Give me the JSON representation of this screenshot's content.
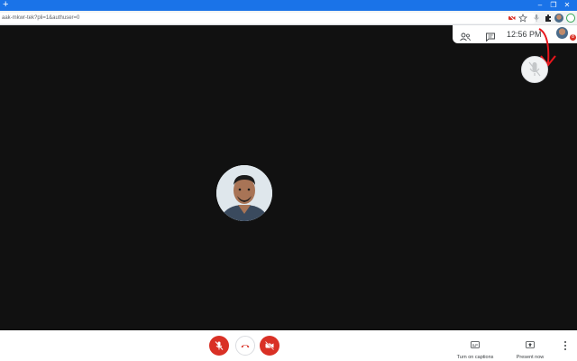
{
  "browser": {
    "new_tab_symbol": "+",
    "url": "aak-mkwr-tek?pli=1&authuser=0",
    "window_controls": [
      "–",
      "❐",
      "✕"
    ]
  },
  "meet": {
    "clock": "12:56 PM",
    "notification_count": "8",
    "bottom": {
      "captions_label": "Turn on captions",
      "present_label": "Present now"
    }
  },
  "colors": {
    "brand_blue": "#1a73e8",
    "meeting_background": "#111111",
    "danger_red": "#d93025",
    "annotation_arrow": "#e8161c"
  },
  "icons": [
    "new-tab-icon",
    "minimize-icon",
    "maximize-icon",
    "close-icon",
    "camera-blocked-icon",
    "star-icon",
    "mic-extension-icon",
    "extensions-icon",
    "profile-avatar-icon",
    "people-icon",
    "chat-icon",
    "muted-mic-icon",
    "hang-up-icon",
    "camera-off-icon",
    "captions-icon",
    "present-icon",
    "more-options-icon"
  ]
}
